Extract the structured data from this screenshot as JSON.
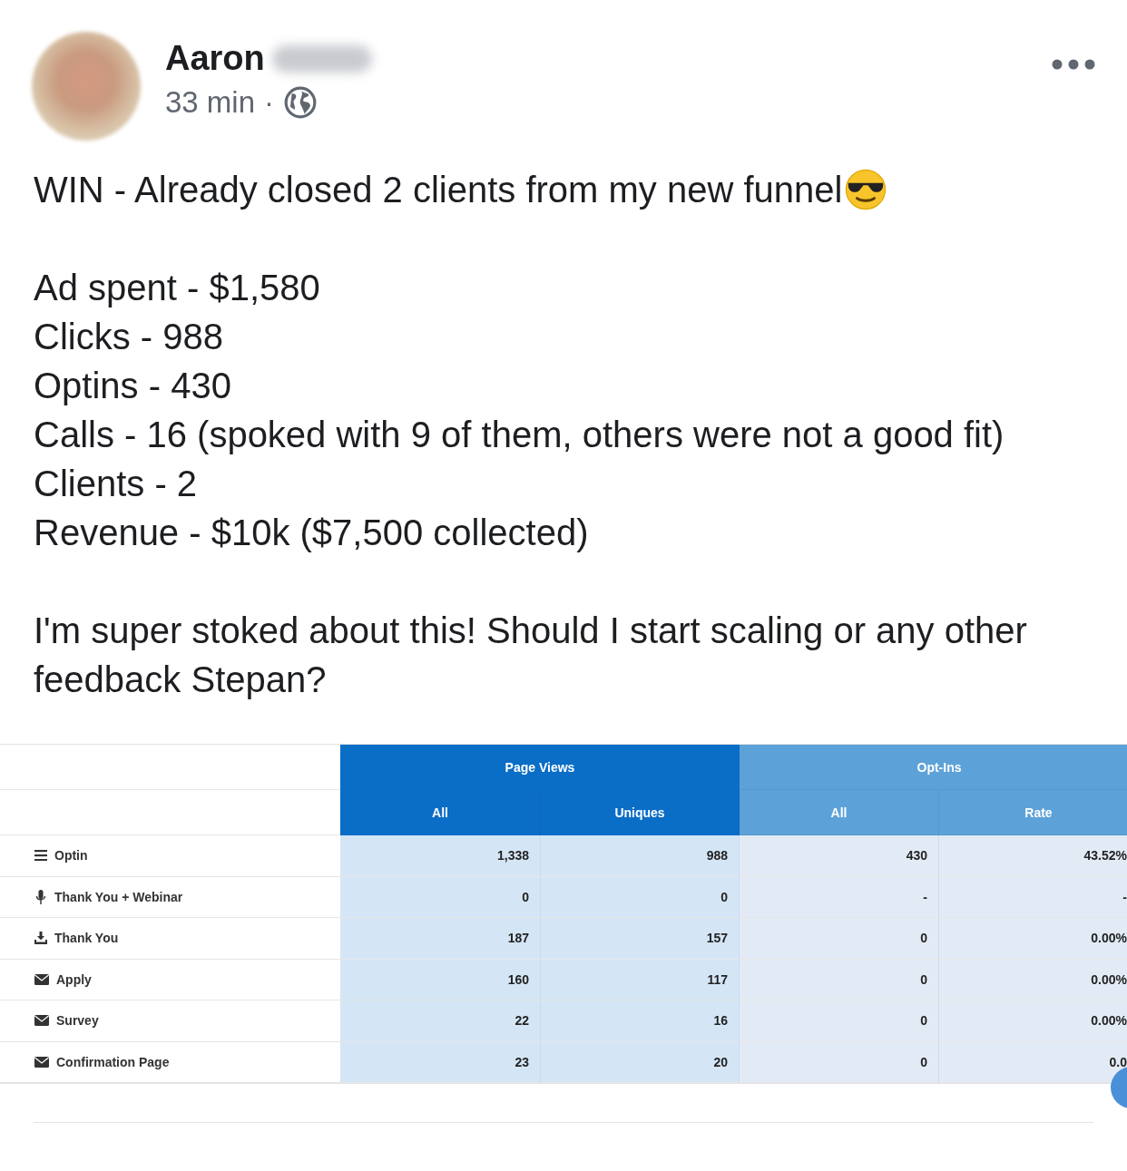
{
  "post": {
    "author": "Aaron",
    "time": "33 min",
    "separator": "·",
    "paragraphs": [
      [
        {
          "text": "WIN - Already closed 2 clients from my new funnel",
          "emoji": true
        }
      ],
      [
        {
          "text": "Ad spent - $1,580",
          "emoji": false
        },
        {
          "text": "Clicks - 988",
          "emoji": false
        },
        {
          "text": "Optins - 430",
          "emoji": false
        },
        {
          "text": "Calls - 16 (spoked with 9 of them, others were not a good fit)",
          "emoji": false
        },
        {
          "text": "Clients - 2",
          "emoji": false
        },
        {
          "text": "Revenue - $10k ($7,500 collected)",
          "emoji": false
        }
      ],
      [
        {
          "text": "I'm super stoked about this! Should I start scaling or any other feedback Stepan?",
          "emoji": false
        }
      ]
    ]
  },
  "table": {
    "groups": [
      {
        "label": "Page Views",
        "kind": "dark"
      },
      {
        "label": "Opt-Ins",
        "kind": "light"
      }
    ],
    "columns": [
      {
        "label": "All",
        "kind": "dark"
      },
      {
        "label": "Uniques",
        "kind": "dark"
      },
      {
        "label": "All",
        "kind": "light"
      },
      {
        "label": "Rate",
        "kind": "light"
      }
    ],
    "rows": [
      {
        "label": "Optin",
        "kind": "list",
        "values": [
          "1,338",
          "988",
          "430",
          "43.52%"
        ]
      },
      {
        "label": "Thank You + Webinar",
        "kind": "mic",
        "values": [
          "0",
          "0",
          "-",
          "-"
        ]
      },
      {
        "label": "Thank You",
        "kind": "download",
        "values": [
          "187",
          "157",
          "0",
          "0.00%"
        ]
      },
      {
        "label": "Apply",
        "kind": "mail",
        "values": [
          "160",
          "117",
          "0",
          "0.00%"
        ]
      },
      {
        "label": "Survey",
        "kind": "mail",
        "values": [
          "22",
          "16",
          "0",
          "0.00%"
        ]
      },
      {
        "label": "Confirmation Page",
        "kind": "mail",
        "values": [
          "23",
          "20",
          "0",
          "0.0"
        ]
      }
    ]
  }
}
